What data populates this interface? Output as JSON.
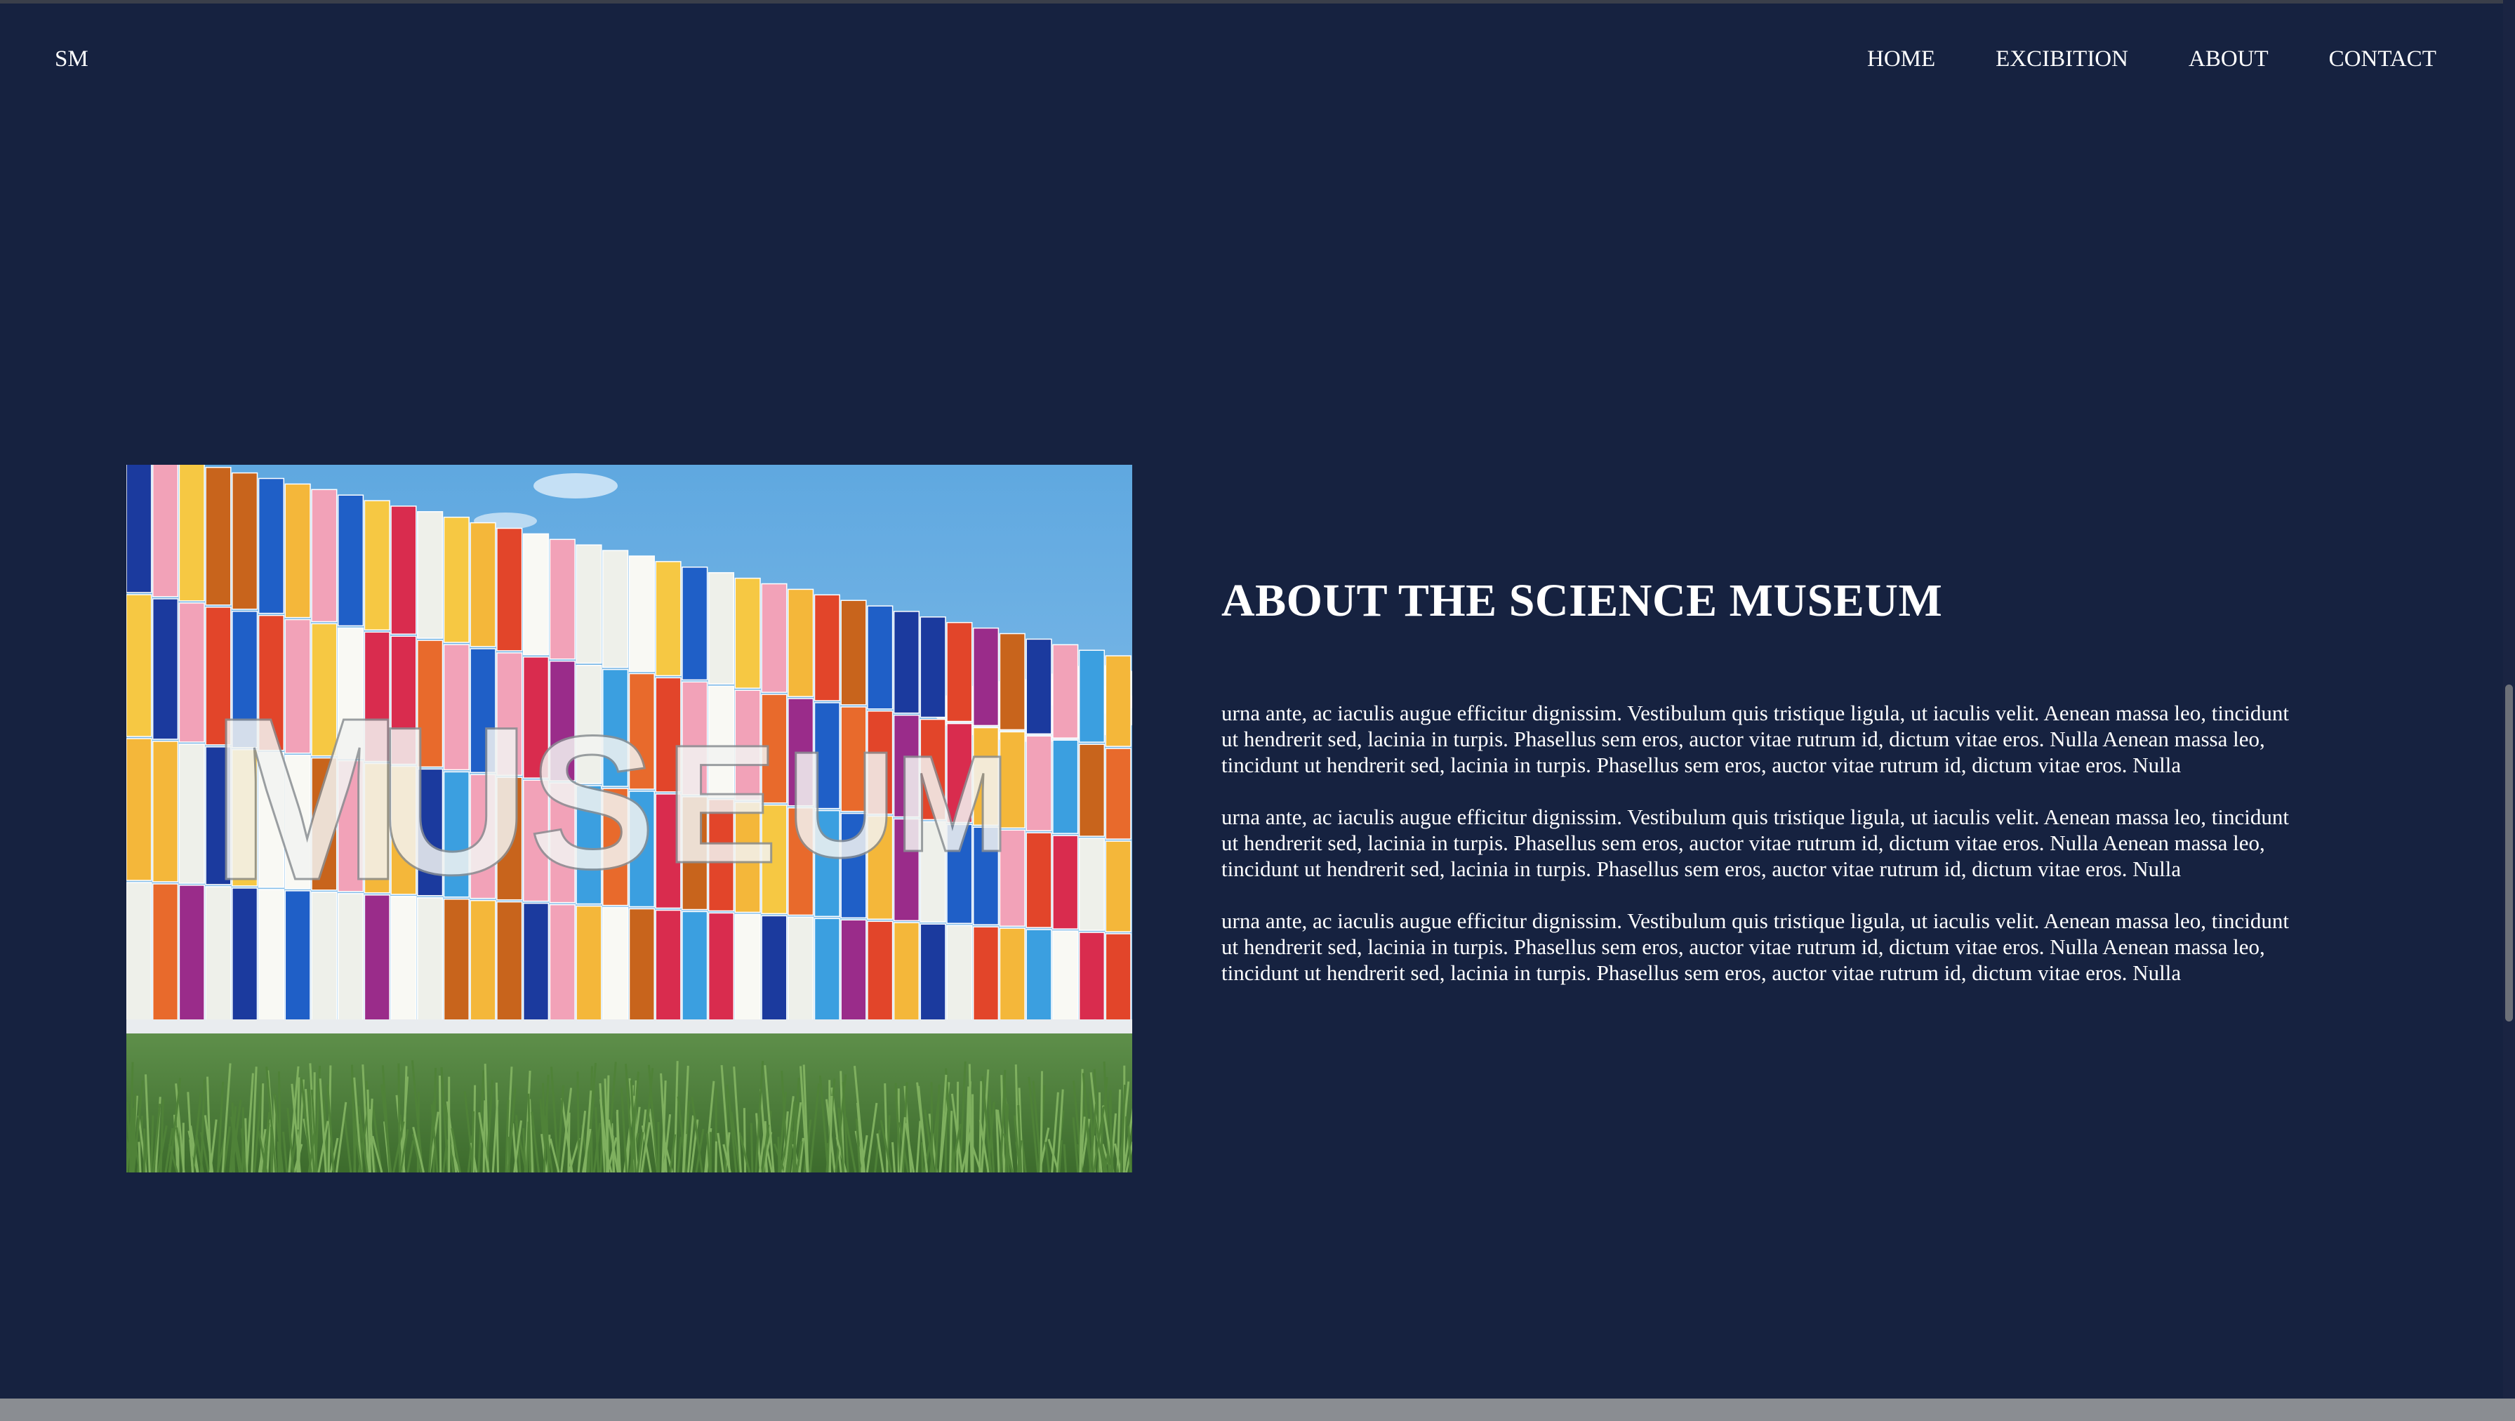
{
  "header": {
    "logo": "SM",
    "nav": [
      "HOME",
      "EXCIBITION",
      "ABOUT",
      "CONTACT"
    ]
  },
  "about": {
    "title": "ABOUT THE SCIENCE MUSEUM",
    "paragraphs": [
      "urna ante, ac iaculis augue efficitur dignissim. Vestibulum quis tristique ligula, ut iaculis velit. Aenean massa leo, tincidunt ut hendrerit sed, lacinia in turpis. Phasellus sem eros, auctor vitae rutrum id, dictum vitae eros. Nulla Aenean massa leo, tincidunt ut hendrerit sed, lacinia in turpis. Phasellus sem eros, auctor vitae rutrum id, dictum vitae eros. Nulla",
      "urna ante, ac iaculis augue efficitur dignissim. Vestibulum quis tristique ligula, ut iaculis velit. Aenean massa leo, tincidunt ut hendrerit sed, lacinia in turpis. Phasellus sem eros, auctor vitae rutrum id, dictum vitae eros. Nulla Aenean massa leo, tincidunt ut hendrerit sed, lacinia in turpis. Phasellus sem eros, auctor vitae rutrum id, dictum vitae eros. Nulla",
      "urna ante, ac iaculis augue efficitur dignissim. Vestibulum quis tristique ligula, ut iaculis velit. Aenean massa leo, tincidunt ut hendrerit sed, lacinia in turpis. Phasellus sem eros, auctor vitae rutrum id, dictum vitae eros. Nulla Aenean massa leo, tincidunt ut hendrerit sed, lacinia in turpis. Phasellus sem eros, auctor vitae rutrum id, dictum vitae eros. Nulla"
    ]
  },
  "image": {
    "sign_text": "MUSEUM"
  },
  "colors": {
    "background": "#162240",
    "text": "#ffffff"
  }
}
